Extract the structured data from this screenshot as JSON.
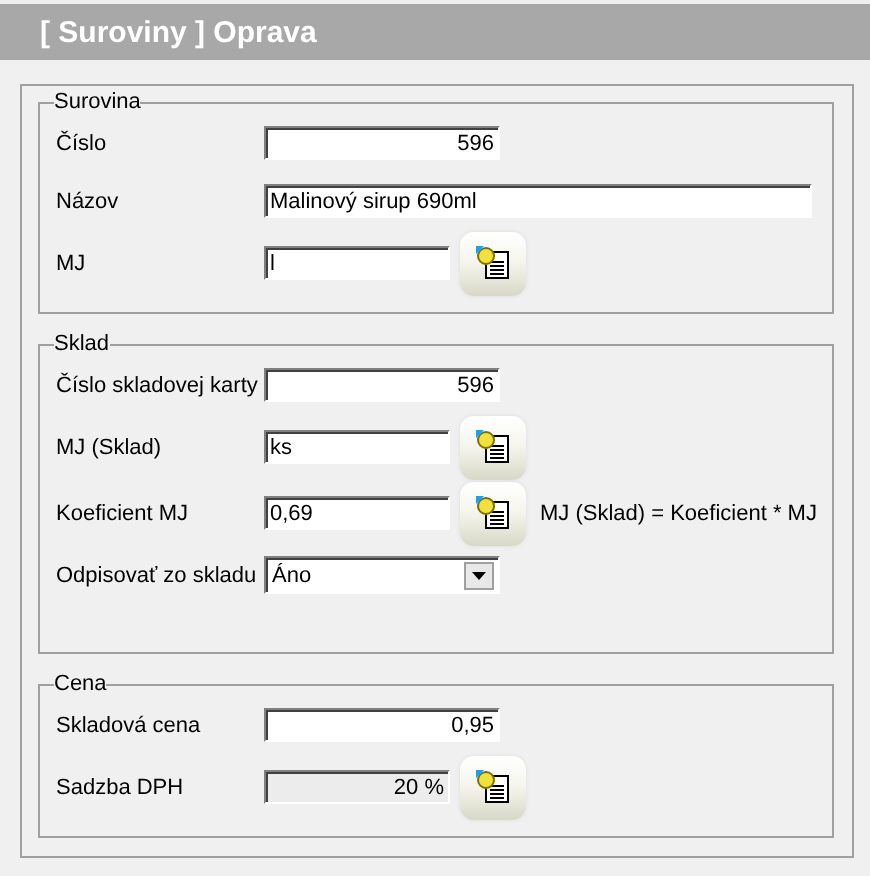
{
  "header": {
    "title": "[ Suroviny ] Oprava"
  },
  "sections": [
    {
      "title": "Surovina",
      "rows": [
        {
          "label": "Číslo",
          "kind": "number",
          "value": "596",
          "disabled": false,
          "picker": false
        },
        {
          "label": "Názov",
          "kind": "wide",
          "value": "Malinový sirup 690ml",
          "disabled": false,
          "picker": false
        },
        {
          "label": "MJ",
          "kind": "text",
          "value": "l",
          "disabled": false,
          "picker": true
        }
      ]
    },
    {
      "title": "Sklad",
      "rows": [
        {
          "label": "Číslo skladovej karty",
          "kind": "number",
          "value": "596",
          "disabled": false,
          "picker": false
        },
        {
          "label": "MJ (Sklad)",
          "kind": "text",
          "value": "ks",
          "disabled": false,
          "picker": true
        },
        {
          "label": "Koeficient MJ",
          "kind": "text",
          "value": "0,69",
          "disabled": false,
          "picker": true,
          "note": "MJ (Sklad) = Koeficient * MJ"
        },
        {
          "label": "Odpisovať zo skladu",
          "kind": "select",
          "value": "Áno",
          "picker": false
        }
      ]
    },
    {
      "title": "Cena",
      "rows": [
        {
          "label": "Skladová cena",
          "kind": "number",
          "value": "0,95",
          "disabled": false,
          "picker": false
        },
        {
          "label": "Sadzba DPH",
          "kind": "number",
          "value": "20 %",
          "disabled": true,
          "picker": true
        }
      ]
    }
  ]
}
